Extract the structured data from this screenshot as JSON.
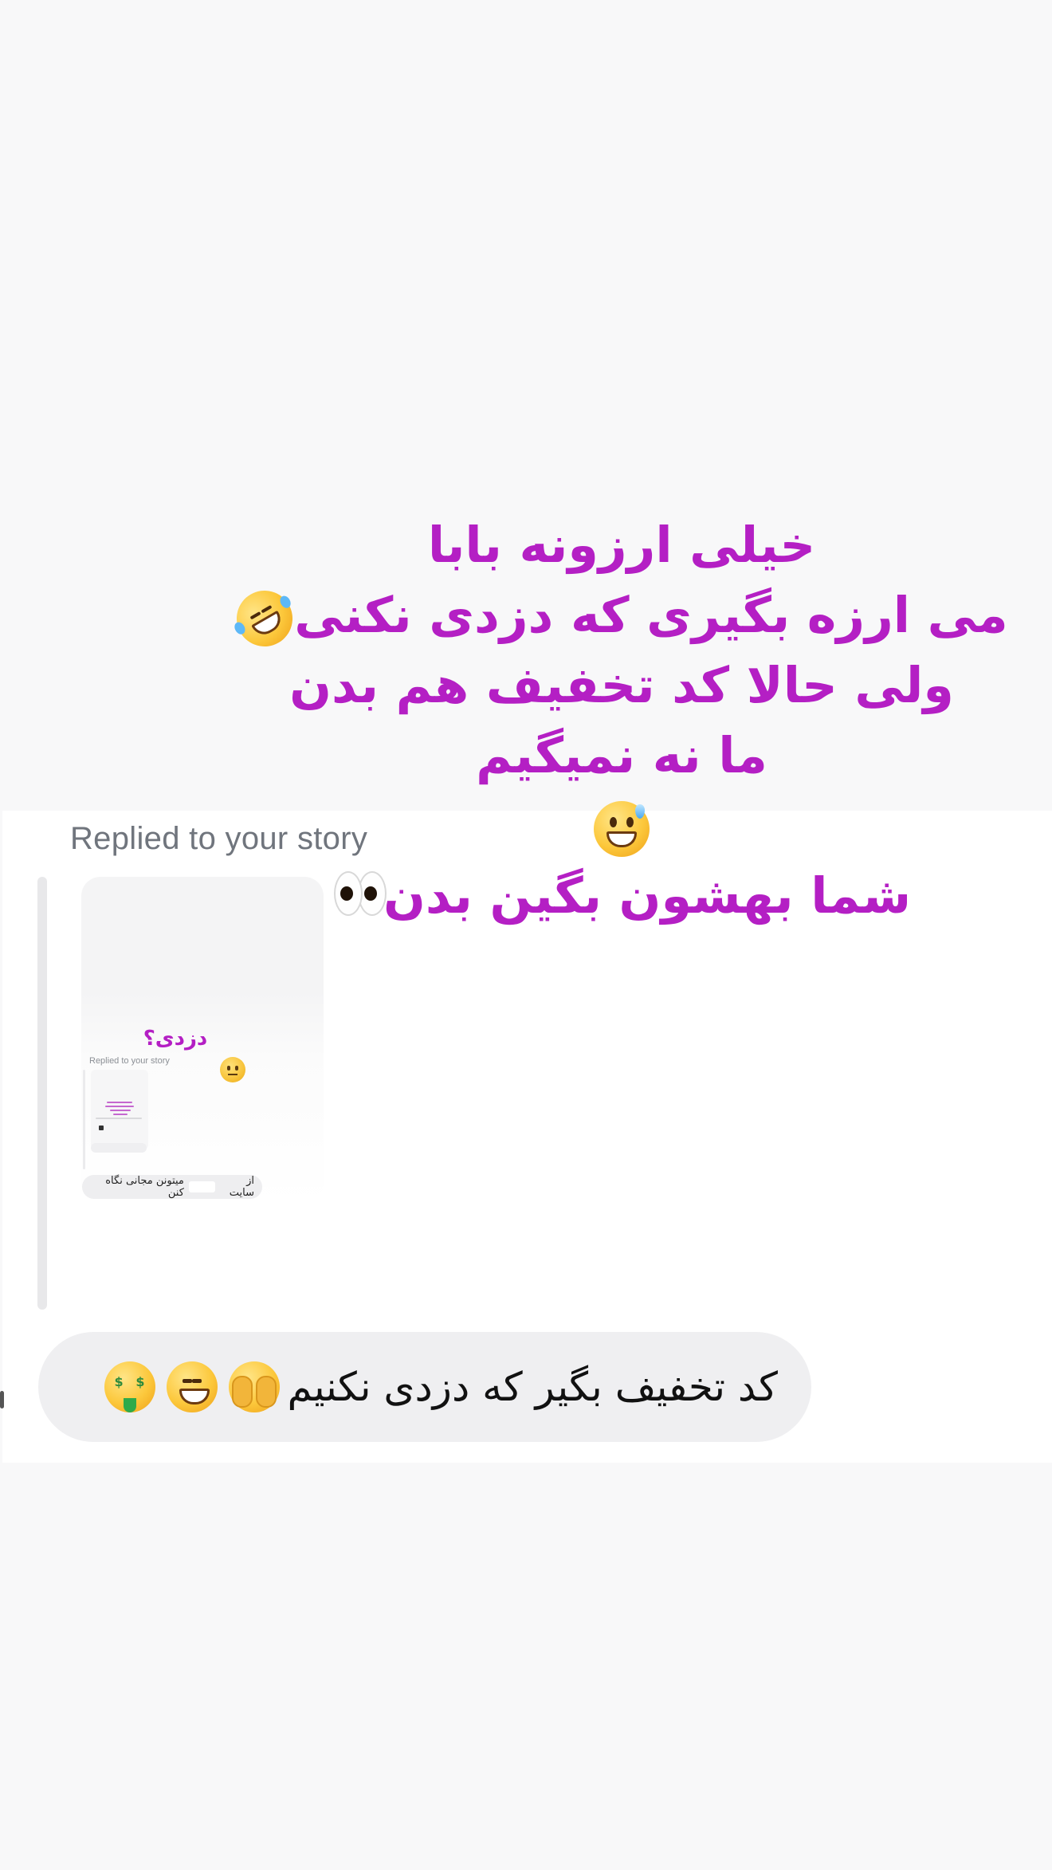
{
  "story_overlay": {
    "lines": [
      "خیلی ارزونه بابا",
      "می ارزه بگیری که دزدی نکنی",
      "ولی حالا کد تخفیف هم بدن",
      "ما نه نمیگیم",
      "",
      "شما بهشون بگین بدن"
    ],
    "line_emojis": [
      "",
      "rofl-icon",
      "",
      "",
      "grinning-sweat-icon",
      "eyes-icon"
    ],
    "color": "#b41fc4"
  },
  "reply": {
    "label": "Replied to your story",
    "thumbnail": {
      "question_text": "دزدی؟",
      "emoji": "neutral-face-icon",
      "nested_label": "Replied to your story",
      "pill_prefix": "از سایت",
      "pill_suffix": "میتونن مجانی نگاه کنن"
    }
  },
  "message": {
    "text": "کد تخفیف بگیر که دزدی نکنیم",
    "emojis": [
      "face-peeking-icon",
      "grinning-squint-icon",
      "money-mouth-icon"
    ]
  }
}
